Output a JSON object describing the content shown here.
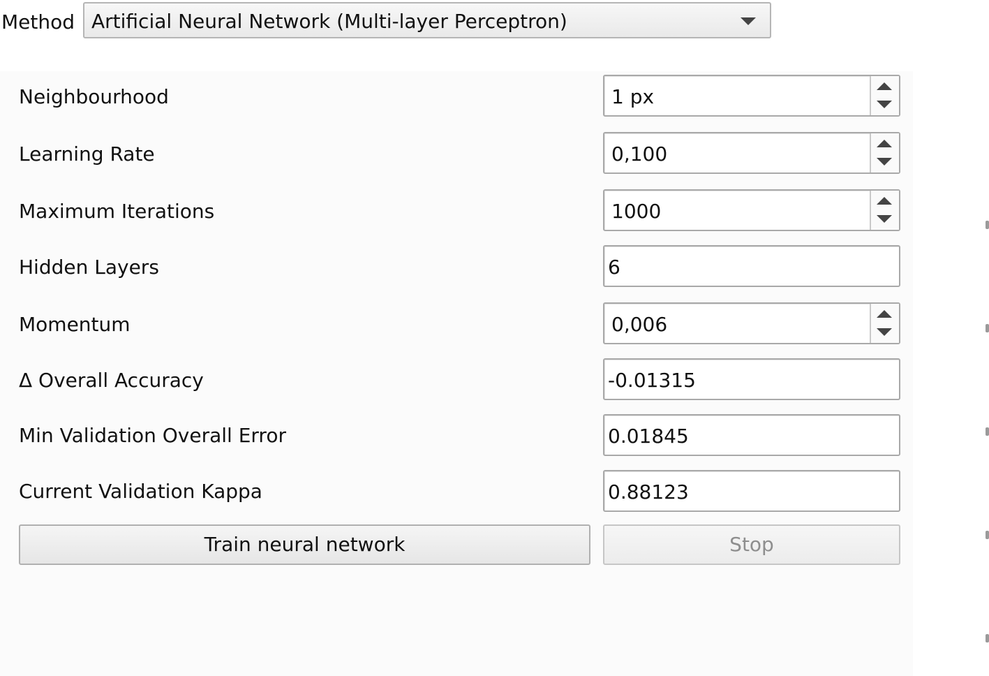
{
  "method": {
    "label": "Method",
    "selected": "Artificial Neural Network (Multi-layer Perceptron)"
  },
  "params": {
    "neighbourhood": {
      "label": "Neighbourhood",
      "value": "1 px"
    },
    "learning_rate": {
      "label": "Learning Rate",
      "value": "0,100"
    },
    "max_iterations": {
      "label": "Maximum Iterations",
      "value": "1000"
    },
    "hidden_layers": {
      "label": "Hidden Layers",
      "value": "6"
    },
    "momentum": {
      "label": "Momentum",
      "value": "0,006"
    }
  },
  "stats": {
    "delta_overall_accuracy": {
      "label": "Δ Overall Accuracy",
      "value": "-0.01315"
    },
    "min_validation_overall_error": {
      "label": "Min Validation Overall Error",
      "value": "0.01845"
    },
    "current_validation_kappa": {
      "label": "Current Validation Kappa",
      "value": "0.88123"
    }
  },
  "buttons": {
    "train": "Train neural network",
    "stop": "Stop"
  },
  "colors": {
    "panel_background": "#fbfbfb",
    "disabled_text": "#8e8e8e",
    "field_border": "#a9a9a9"
  }
}
